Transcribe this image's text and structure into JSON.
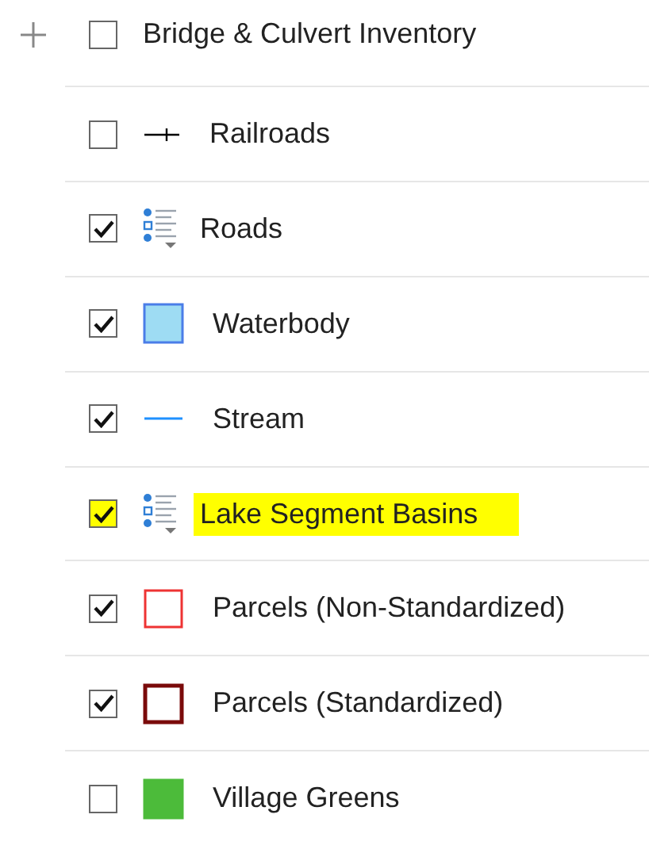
{
  "layers": [
    {
      "kind": "group",
      "label": "Bridge & Culvert Inventory",
      "checked": false,
      "highlighted": false
    },
    {
      "kind": "railroad",
      "label": "Railroads",
      "checked": false,
      "highlighted": false,
      "color": "#000000"
    },
    {
      "kind": "legend",
      "label": "Roads",
      "checked": true,
      "highlighted": false
    },
    {
      "kind": "fill",
      "label": "Waterbody",
      "checked": true,
      "highlighted": false,
      "color": "#9edcf3"
    },
    {
      "kind": "line",
      "label": "Stream",
      "checked": true,
      "highlighted": false,
      "color": "#1e90ff"
    },
    {
      "kind": "legend",
      "label": "Lake Segment Basins",
      "checked": true,
      "highlighted": true
    },
    {
      "kind": "outline",
      "label": "Parcels (Non-Standardized)",
      "checked": true,
      "highlighted": false,
      "color": "#ee3333"
    },
    {
      "kind": "outline",
      "label": "Parcels (Standardized)",
      "checked": true,
      "highlighted": false,
      "color": "#7a0a0a"
    },
    {
      "kind": "fill",
      "label": "Village Greens",
      "checked": false,
      "highlighted": false,
      "color": "#4cbb3a"
    }
  ]
}
